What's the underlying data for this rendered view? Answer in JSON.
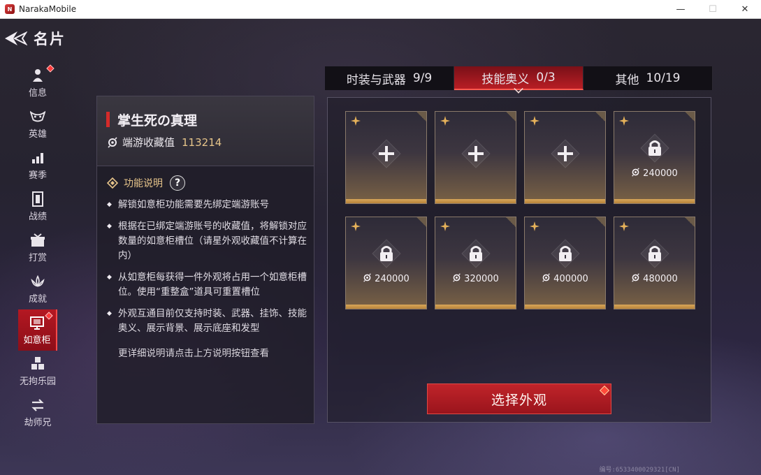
{
  "window": {
    "title": "NarakaMobile",
    "icon_label": "N",
    "minimize": "—",
    "maximize": "☐",
    "close": "✕"
  },
  "header": {
    "title": "名片"
  },
  "sidebar": {
    "items": [
      {
        "label": "信息",
        "icon": "person-icon",
        "badge": true
      },
      {
        "label": "英雄",
        "icon": "mask-icon",
        "badge": false
      },
      {
        "label": "赛季",
        "icon": "bars-icon",
        "badge": false
      },
      {
        "label": "战绩",
        "icon": "banner-icon",
        "badge": false
      },
      {
        "label": "打赏",
        "icon": "gift-icon",
        "badge": false
      },
      {
        "label": "成就",
        "icon": "lotus-icon",
        "badge": false
      },
      {
        "label": "如意柜",
        "icon": "cabinet-icon",
        "badge": true,
        "active": true
      },
      {
        "label": "无拘乐园",
        "icon": "cubes-icon",
        "badge": false
      },
      {
        "label": "劫师兄",
        "icon": "swap-icon",
        "badge": false
      }
    ]
  },
  "info": {
    "card_name": "掌生死の真理",
    "collection_label": "端游收藏值",
    "collection_value": "113214",
    "func_title": "功能说明",
    "help": "?",
    "bullets": [
      "解锁如意柜功能需要先绑定端游账号",
      "根据在已绑定端游账号的收藏值，将解锁对应数量的如意柜槽位（请星外观收藏值不计算在内）",
      "从如意柜每获得一件外观将占用一个如意柜槽位。使用“重整盒”道具可重置槽位",
      "外观互通目前仅支持时装、武器、挂饰、技能奥义、展示背景、展示底座和发型"
    ],
    "note": "更详细说明请点击上方说明按钮查看"
  },
  "tabs": [
    {
      "label": "时装与武器",
      "count": "9/9",
      "active": false
    },
    {
      "label": "技能奥义",
      "count": "0/3",
      "active": true
    },
    {
      "label": "其他",
      "count": "10/19",
      "active": false
    }
  ],
  "slots": [
    {
      "state": "add"
    },
    {
      "state": "add"
    },
    {
      "state": "add"
    },
    {
      "state": "locked",
      "price": "240000"
    },
    {
      "state": "locked",
      "price": "240000"
    },
    {
      "state": "locked",
      "price": "320000"
    },
    {
      "state": "locked",
      "price": "400000"
    },
    {
      "state": "locked",
      "price": "480000"
    }
  ],
  "select_button": "选择外观",
  "uid": "编号:6533400029321[CN]",
  "colors": {
    "accent_red": "#b81e24",
    "gold": "#e6c48a",
    "slot_bottom": "#d8a75a"
  }
}
